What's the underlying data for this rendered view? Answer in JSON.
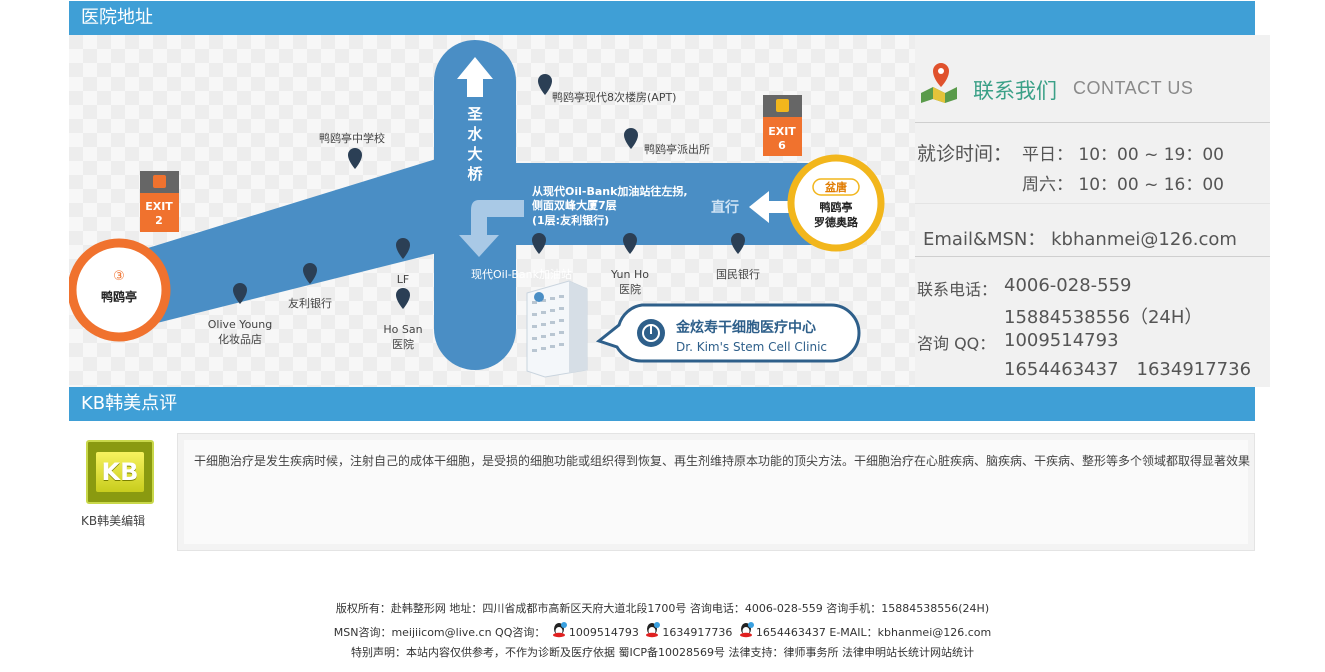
{
  "section1": {
    "title": "医院地址"
  },
  "map": {
    "road_vertical": [
      "圣",
      "水",
      "大",
      "桥"
    ],
    "exit_left": {
      "label": "EXIT",
      "num": "2"
    },
    "exit_right": {
      "label": "EXIT",
      "num": "6"
    },
    "station_left": {
      "num": "③",
      "name": "鸭鸥亭"
    },
    "station_right": {
      "line": "盆唐",
      "name1": "鸭鸥亭",
      "name2": "罗德奥路"
    },
    "direction_text": [
      "从现代Oil-Bank加油站往左拐,",
      "侧面双峰大厦7层",
      "(1层:友利银行)"
    ],
    "straight": "直行",
    "landmarks": {
      "apt": "鸭鸥亭现代8次楼房(APT)",
      "police": "鸭鸥亭派出所",
      "school": "鸭鸥亭中学校",
      "oilbank": "现代Oil-Bank加油站",
      "yunho1": "Yun Ho",
      "yunho2": "医院",
      "kookmin": "国民银行",
      "lf": "LF",
      "hosan1": "Ho San",
      "hosan2": "医院",
      "woori": "友利银行",
      "olive1": "Olive Young",
      "olive2": "化妆品店"
    },
    "clinic": {
      "cn": "金炫寿干细胞医疗中心",
      "en": "Dr. Kim's Stem Cell Clinic"
    }
  },
  "contact": {
    "title": "联系我们",
    "subtitle": "CONTACT US",
    "hours_label": "就诊时间：",
    "weekday": "平日： 10：00 ~ 19：00",
    "saturday": "周六： 10：00 ~ 16：00",
    "email": "Email&MSN： kbhanmei@126.com",
    "phone_label": "联系电话：",
    "phone1": "4006-028-559",
    "phone2": "15884538556（24H）",
    "qq_label": "咨询 QQ：",
    "qq1": "1009514793",
    "qq2": "1654463437　1634917736"
  },
  "section2": {
    "title": "KB韩美点评"
  },
  "review": {
    "logo_text": "KB",
    "editor": "KB韩美编辑",
    "text": "干细胞治疗是发生疾病时候，注射自己的成体干细胞，是受损的细胞功能或组织得到恢复、再生剂维持原本功能的顶尖方法。干细胞治疗在心脏疾病、脑疾病、干疾病、整形等多个领域都取得显著效果"
  },
  "footer": {
    "line1": "版权所有：赴韩整形网 地址：四川省成都市高新区天府大道北段1700号 咨询电话：4006-028-559 咨询手机：15884538556(24H)",
    "line2_a": "MSN咨询：meijiicom@live.cn QQ咨询：",
    "qq_a": "1009514793",
    "qq_b": "1634917736",
    "qq_c": "1654463437",
    "line2_b": " E-MAIL：kbhanmei@126.com",
    "line3": "特别声明：本站内容仅供参考，不作为诊断及医疗依据 蜀ICP备10028569号 法律支持：律师事务所 法律申明站长统计网站统计"
  },
  "colors": {
    "header": "#3f9fd6",
    "road": "#4a8ec5",
    "exit_orange": "#f0722e",
    "station_right": "#f2b61c",
    "contact_green": "#3aa087"
  }
}
